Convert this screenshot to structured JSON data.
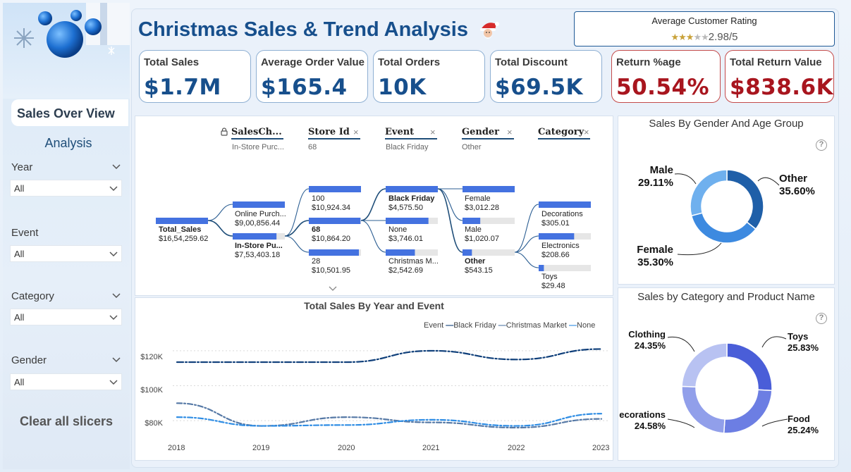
{
  "header": {
    "title": "Christmas Sales & Trend Analysis",
    "rating_title": "Average Customer Rating",
    "rating_value": "2.98/5",
    "rating_stars": 2.98
  },
  "kpis": [
    {
      "label": "Total Sales",
      "value": "$1.7M"
    },
    {
      "label": "Average Order Value",
      "value": "$165.4"
    },
    {
      "label": "Total Orders",
      "value": "10K"
    },
    {
      "label": "Total Discount",
      "value": "$69.5K"
    },
    {
      "label": "Return %age",
      "value": "50.54%"
    },
    {
      "label": "Total Return Value",
      "value": "$838.6K"
    }
  ],
  "sidebar": {
    "nav_label": "Sales Over View",
    "analysis_label": "Analysis",
    "slicers": [
      {
        "label": "Year",
        "value": "All"
      },
      {
        "label": "Event",
        "value": "All"
      },
      {
        "label": "Category",
        "value": "All"
      },
      {
        "label": "Gender",
        "value": "All"
      }
    ],
    "clear_label": "Clear all slicers"
  },
  "tree": {
    "headers": [
      {
        "label": "SalesCh...",
        "sub": "In-Store Purc..."
      },
      {
        "label": "Store Id",
        "sub": "68"
      },
      {
        "label": "Event",
        "sub": "Black Friday"
      },
      {
        "label": "Gender",
        "sub": "Other"
      },
      {
        "label": "Category",
        "sub": ""
      }
    ],
    "root": {
      "name": "Total_Sales",
      "value": "$16,54,259.62"
    },
    "channel": [
      {
        "name": "Online Purch...",
        "value": "$9,00,856.44",
        "fill": 1.0
      },
      {
        "name": "In-Store Pu...",
        "value": "$7,53,403.18",
        "fill": 0.84
      }
    ],
    "store": [
      {
        "name": "100",
        "value": "$10,924.34",
        "fill": 1.0
      },
      {
        "name": "68",
        "value": "$10,864.20",
        "fill": 0.99
      },
      {
        "name": "28",
        "value": "$10,501.95",
        "fill": 0.96
      }
    ],
    "event": [
      {
        "name": "Black Friday",
        "value": "$4,575.50",
        "fill": 1.0
      },
      {
        "name": "None",
        "value": "$3,746.01",
        "fill": 0.82
      },
      {
        "name": "Christmas M...",
        "value": "$2,542.69",
        "fill": 0.56
      }
    ],
    "gender": [
      {
        "name": "Female",
        "value": "$3,012.28",
        "fill": 1.0
      },
      {
        "name": "Male",
        "value": "$1,020.07",
        "fill": 0.34
      },
      {
        "name": "Other",
        "value": "$543.15",
        "fill": 0.18
      }
    ],
    "category": [
      {
        "name": "Decorations",
        "value": "$305.01",
        "fill": 1.0
      },
      {
        "name": "Electronics",
        "value": "$208.66",
        "fill": 0.68
      },
      {
        "name": "Toys",
        "value": "$29.48",
        "fill": 0.1
      }
    ]
  },
  "gender_chart": {
    "title": "Sales By Gender And Age Group",
    "help": "?",
    "slices": [
      {
        "name": "Other",
        "pct": "35.60%",
        "value": 35.6,
        "color": "#1f5fa8"
      },
      {
        "name": "Female",
        "pct": "35.30%",
        "value": 35.3,
        "color": "#3d8ae0"
      },
      {
        "name": "Male",
        "pct": "29.11%",
        "value": 29.11,
        "color": "#6fb0ee"
      }
    ]
  },
  "category_chart": {
    "title": "Sales by Category and Product Name",
    "help": "?",
    "slices": [
      {
        "name": "Toys",
        "pct": "25.83%",
        "value": 25.83,
        "color": "#4a5ed8"
      },
      {
        "name": "Food",
        "pct": "25.24%",
        "value": 25.24,
        "color": "#6c7ee3"
      },
      {
        "name": "ecorations",
        "pct": "24.58%",
        "value": 24.58,
        "color": "#919fea"
      },
      {
        "name": "Clothing",
        "pct": "24.35%",
        "value": 24.35,
        "color": "#b8c2f2"
      }
    ]
  },
  "chart_data": {
    "type": "line",
    "title": "Total Sales By Year and Event",
    "x": [
      2018,
      2019,
      2020,
      2021,
      2022,
      2023
    ],
    "ylim": [
      74000,
      124000
    ],
    "yticks": [
      80000,
      100000,
      120000
    ],
    "ytick_labels": [
      "$80K",
      "$100K",
      "$120K"
    ],
    "legend_title": "Event",
    "series": [
      {
        "name": "Black Friday",
        "values": [
          113500,
          113500,
          113500,
          120000,
          115000,
          121000
        ],
        "color": "#0f3f7a"
      },
      {
        "name": "Christmas Market",
        "values": [
          90000,
          77000,
          82000,
          79000,
          76000,
          81000
        ],
        "color": "#5679a6"
      },
      {
        "name": "None",
        "values": [
          82000,
          77000,
          77500,
          80500,
          77000,
          84000
        ],
        "color": "#2f8de4"
      }
    ]
  }
}
